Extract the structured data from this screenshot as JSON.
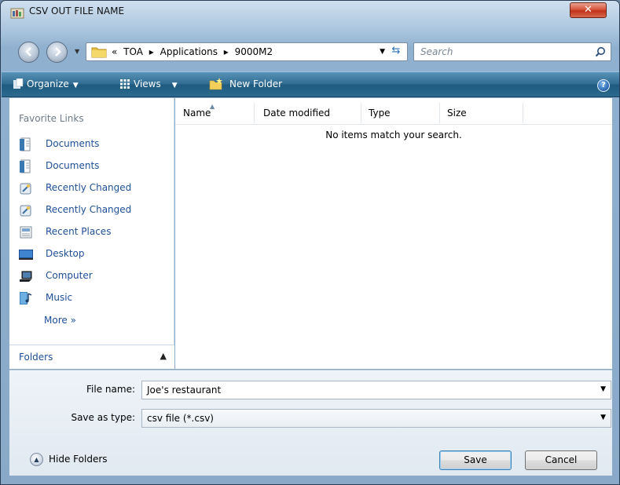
{
  "window": {
    "title": "CSV OUT FILE NAME"
  },
  "address": {
    "breadcrumb": [
      "«",
      "TOA",
      "▸",
      "Applications",
      "▸",
      "9000M2"
    ]
  },
  "search": {
    "placeholder": "Search"
  },
  "toolbar": {
    "organize_label": "Organize",
    "views_label": "Views",
    "new_folder_label": "New Folder",
    "help_glyph": "?"
  },
  "sidebar": {
    "header": "Favorite Links",
    "items": [
      {
        "label": "Documents",
        "icon": "documents-icon"
      },
      {
        "label": "Documents",
        "icon": "documents-icon"
      },
      {
        "label": "Recently Changed",
        "icon": "recently-changed-icon"
      },
      {
        "label": "Recently Changed",
        "icon": "recently-changed-icon"
      },
      {
        "label": "Recent Places",
        "icon": "recent-places-icon"
      },
      {
        "label": "Desktop",
        "icon": "desktop-icon"
      },
      {
        "label": "Computer",
        "icon": "computer-icon"
      },
      {
        "label": "Music",
        "icon": "music-icon"
      }
    ],
    "more_label": "More »",
    "folders_label": "Folders"
  },
  "file_list": {
    "columns": [
      "Name",
      "Date modified",
      "Type",
      "Size"
    ],
    "empty_message": "No items match your search."
  },
  "form": {
    "file_name_label": "File name:",
    "file_name_value": "Joe's restaurant",
    "save_type_label": "Save as type:",
    "save_type_value": "csv file (*.csv)"
  },
  "footer": {
    "hide_folders_label": "Hide Folders",
    "save_label": "Save",
    "cancel_label": "Cancel"
  },
  "colors": {
    "link_blue": "#1e4f98",
    "toolbar_blue": "#2f6b92",
    "close_red": "#c2321b"
  }
}
